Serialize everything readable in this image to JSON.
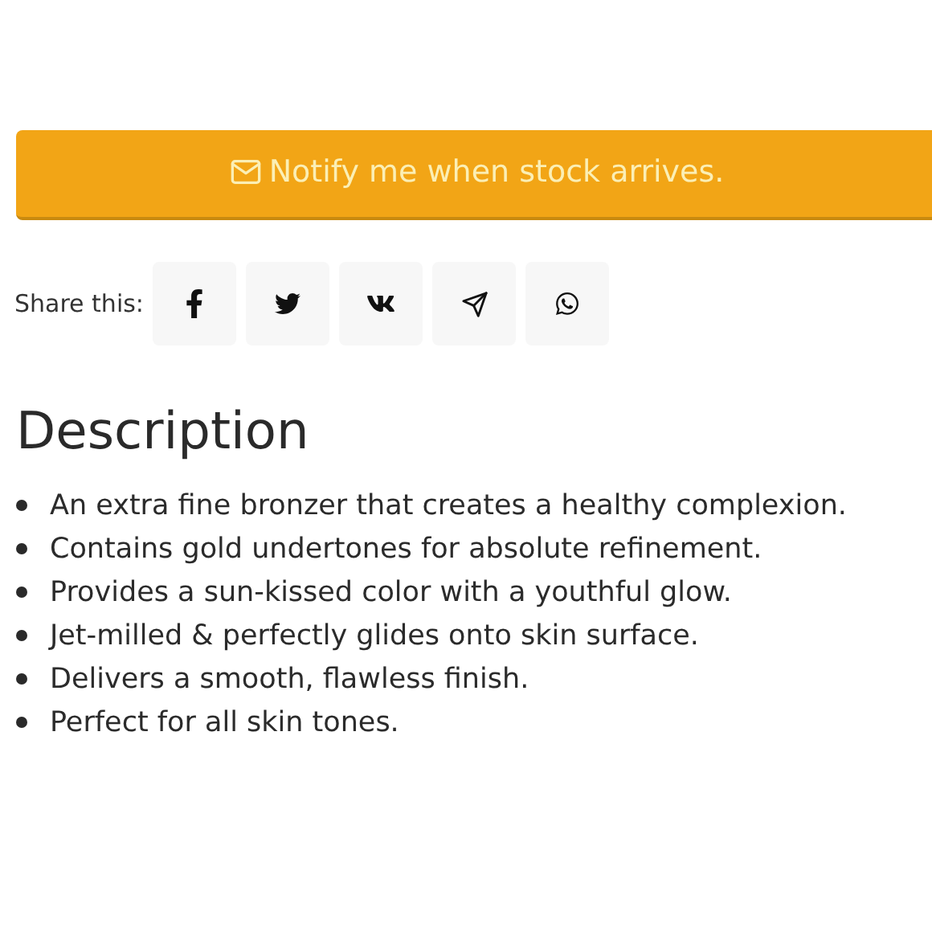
{
  "notify_button": {
    "label": "Notify me when stock arrives."
  },
  "share": {
    "label": "Share this:",
    "buttons": [
      {
        "kind": "facebook"
      },
      {
        "kind": "twitter"
      },
      {
        "kind": "vk"
      },
      {
        "kind": "telegram"
      },
      {
        "kind": "whatsapp"
      }
    ]
  },
  "description": {
    "heading": "Description",
    "items": [
      "An extra fine bronzer that creates a healthy complexion.",
      "Contains gold undertones for absolute refinement.",
      "Provides a sun-kissed color with a youthful glow.",
      "Jet-milled & perfectly glides onto skin surface.",
      "Delivers a smooth, flawless finish.",
      "Perfect for all skin tones."
    ]
  }
}
